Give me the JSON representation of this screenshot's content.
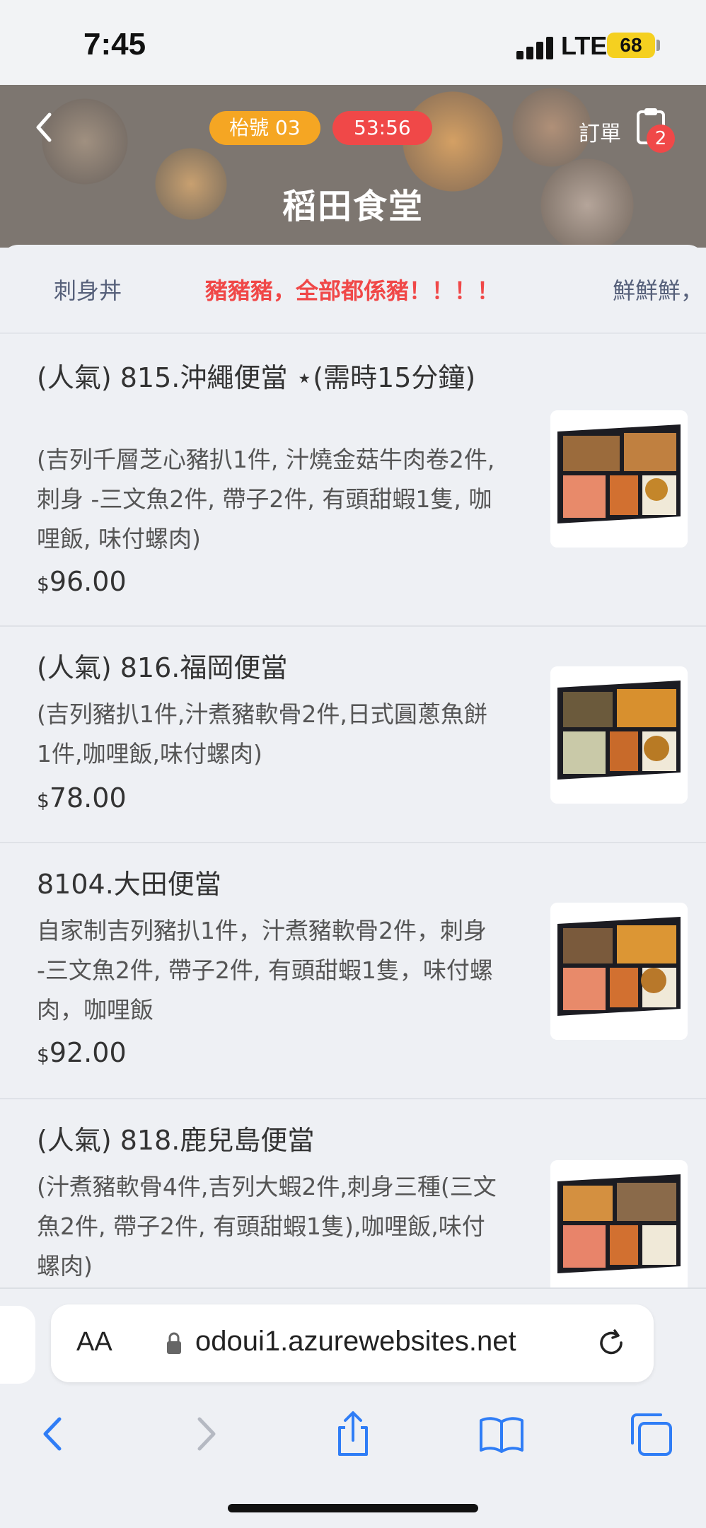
{
  "status": {
    "time": "7:45",
    "network": "LTE",
    "battery": "68"
  },
  "header": {
    "table_badge": "枱號  03",
    "timer": "53:56",
    "order_label": "訂單",
    "order_count": "2",
    "restaurant_name": "稻田食堂"
  },
  "tabs": [
    {
      "label": "刺身丼",
      "active": false
    },
    {
      "label": "豬豬豬，全部都係豬！！！！",
      "active": true
    },
    {
      "label": "鮮鮮鮮，",
      "active": false
    }
  ],
  "menu_items": [
    {
      "title": "(人氣) 815.沖繩便當 ⋆(需時15分鐘)",
      "description": "(吉列千層芝心豬扒1件, 汁燒金菇牛肉卷2件, 刺身 -三文魚2件, 帶子2件, 有頭甜蝦1隻, 咖哩飯, 味付螺肉)",
      "currency": "$",
      "price": "96.00"
    },
    {
      "title": "(人氣) 816.福岡便當",
      "description": "(吉列豬扒1件,汁煮豬軟骨2件,日式圓蔥魚餅1件,咖哩飯,味付螺肉)",
      "currency": "$",
      "price": "78.00"
    },
    {
      "title": "8104.大田便當",
      "description": "自家制吉列豬扒1件，汁煮豬軟骨2件，刺身 -三文魚2件, 帶子2件, 有頭甜蝦1隻，味付螺肉，咖哩飯",
      "currency": "$",
      "price": "92.00"
    },
    {
      "title": "(人氣) 818.鹿兒島便當",
      "description": "(汁煮豬軟骨4件,吉列大蝦2件,刺身三種(三文魚2件, 帶子2件, 有頭甜蝦1隻),咖哩飯,味付螺肉)",
      "currency": "$",
      "price": ""
    }
  ],
  "browser": {
    "text_size_label": "AA",
    "url": "odoui1.azurewebsites.net"
  },
  "colors": {
    "accent": "#f04848",
    "badge": "#f5a623",
    "link": "#2f7df6"
  }
}
